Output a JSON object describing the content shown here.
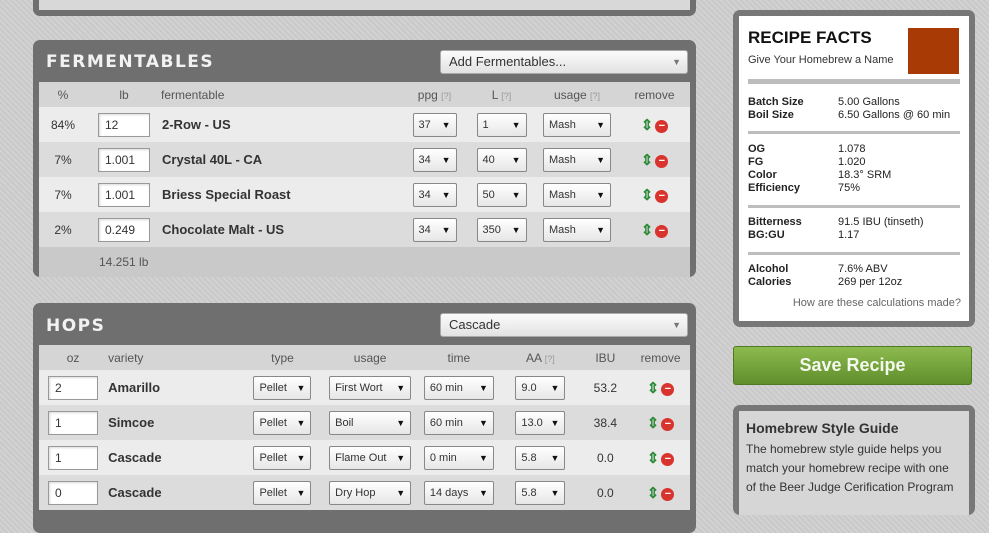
{
  "fermentables": {
    "title": "FERMENTABLES",
    "add_placeholder": "Add Fermentables...",
    "columns": {
      "percent": "%",
      "lb": "lb",
      "fermentable": "fermentable",
      "ppg": "ppg",
      "L": "L",
      "usage": "usage",
      "remove": "remove",
      "help": "[?]"
    },
    "rows": [
      {
        "percent": "84%",
        "lb": "12",
        "name": "2-Row - US",
        "ppg": "37",
        "L": "1",
        "usage": "Mash"
      },
      {
        "percent": "7%",
        "lb": "1.001",
        "name": "Crystal 40L - CA",
        "ppg": "34",
        "L": "40",
        "usage": "Mash"
      },
      {
        "percent": "7%",
        "lb": "1.001",
        "name": "Briess Special Roast",
        "ppg": "34",
        "L": "50",
        "usage": "Mash"
      },
      {
        "percent": "2%",
        "lb": "0.249",
        "name": "Chocolate Malt - US",
        "ppg": "34",
        "L": "350",
        "usage": "Mash"
      }
    ],
    "total": "14.251 lb"
  },
  "hops": {
    "title": "HOPS",
    "add_selected": "Cascade",
    "columns": {
      "oz": "oz",
      "variety": "variety",
      "type": "type",
      "usage": "usage",
      "time": "time",
      "aa": "AA",
      "ibu": "IBU",
      "remove": "remove",
      "help": "[?]"
    },
    "rows": [
      {
        "oz": "2",
        "variety": "Amarillo",
        "type": "Pellet",
        "usage": "First Wort",
        "time": "60 min",
        "aa": "9.0",
        "ibu": "53.2"
      },
      {
        "oz": "1",
        "variety": "Simcoe",
        "type": "Pellet",
        "usage": "Boil",
        "time": "60 min",
        "aa": "13.0",
        "ibu": "38.4"
      },
      {
        "oz": "1",
        "variety": "Cascade",
        "type": "Pellet",
        "usage": "Flame Out",
        "time": "0 min",
        "aa": "5.8",
        "ibu": "0.0"
      },
      {
        "oz": "0",
        "variety": "Cascade",
        "type": "Pellet",
        "usage": "Dry Hop",
        "time": "14 days",
        "aa": "5.8",
        "ibu": "0.0"
      }
    ]
  },
  "facts": {
    "title": "RECIPE FACTS",
    "name_placeholder": "Give Your Homebrew a Name",
    "color_swatch": "#a83a06",
    "rows": [
      {
        "label": "Batch Size",
        "value": "5.00 Gallons"
      },
      {
        "label": "Boil Size",
        "value": "6.50 Gallons @ 60 min"
      },
      {
        "label": "OG",
        "value": "1.078"
      },
      {
        "label": "FG",
        "value": "1.020"
      },
      {
        "label": "Color",
        "value": "18.3° SRM"
      },
      {
        "label": "Efficiency",
        "value": "75%"
      },
      {
        "label": "Bitterness",
        "value": "91.5 IBU (tinseth)"
      },
      {
        "label": "BG:GU",
        "value": "1.17"
      },
      {
        "label": "Alcohol",
        "value": "7.6% ABV"
      },
      {
        "label": "Calories",
        "value": "269 per 12oz"
      }
    ],
    "calc_link": "How are these calculations made?"
  },
  "save_button": "Save Recipe",
  "style_guide": {
    "title": "Homebrew Style Guide",
    "text": "The homebrew style guide helps you match your homebrew recipe with one of the Beer Judge Cerification Program"
  },
  "icons": {
    "move": "up-down-arrow-icon",
    "remove": "remove-icon",
    "dropdown": "chevron-down-icon"
  },
  "colors": {
    "panel": "#6f6f6f",
    "save_green": "#6f9d37",
    "remove_red": "#d8332c",
    "move_green": "#2e8b3a"
  }
}
